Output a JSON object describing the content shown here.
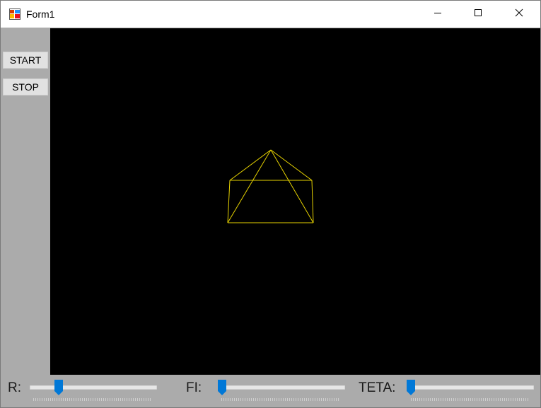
{
  "window": {
    "title": "Form1",
    "controls": {
      "minimize_icon": "minimize-icon",
      "maximize_icon": "maximize-icon",
      "close_icon": "close-icon"
    }
  },
  "buttons": {
    "start_label": "START",
    "stop_label": "STOP"
  },
  "canvas": {
    "background": "#000000",
    "wireframe_color": "#e6d200"
  },
  "sliders": [
    {
      "label": "R:",
      "value_fraction": 0.2
    },
    {
      "label": "FI:",
      "value_fraction": 0.0
    },
    {
      "label": "TETA:",
      "value_fraction": 0.0
    }
  ],
  "colors": {
    "form_background": "#ababab",
    "slider_thumb": "#0078d7"
  }
}
